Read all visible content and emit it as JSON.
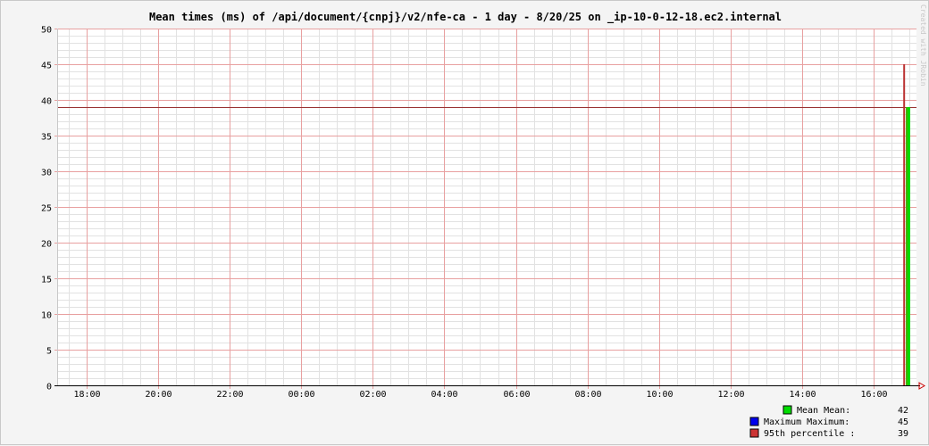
{
  "chart_data": {
    "type": "area",
    "title": "Mean times (ms) of /api/document/{cnpj}/v2/nfe-ca - 1 day - 8/20/25 on _ip-10-0-12-18.ec2.internal",
    "watermark": "Created with JRobin",
    "x_tick_labels": [
      "18:00",
      "20:00",
      "22:00",
      "00:00",
      "02:00",
      "04:00",
      "06:00",
      "08:00",
      "10:00",
      "12:00",
      "14:00",
      "16:00"
    ],
    "x_range_hours": [
      17.2,
      41.2
    ],
    "y_ticks": [
      0,
      5,
      10,
      15,
      20,
      25,
      30,
      35,
      40,
      45,
      50
    ],
    "ylim": [
      0,
      50
    ],
    "grid": true,
    "series": [
      {
        "name": "Mean",
        "color": "#00dd00",
        "x_hours": [
          40.85,
          41.0
        ],
        "values": [
          39,
          39
        ]
      },
      {
        "name": "Maximum",
        "color": "#0000ff",
        "x_hours": [
          40.83,
          41.0
        ],
        "values": [
          45,
          45
        ]
      },
      {
        "name": "95th percentile",
        "color": "#bb3333",
        "x_hours": [
          40.83,
          41.0
        ],
        "values": [
          45,
          45
        ]
      }
    ],
    "threshold_line": {
      "value": 39,
      "color": "#993333"
    },
    "legend": {
      "placement": "bottom-right",
      "rows": [
        {
          "swatch": "#00dd00",
          "text": "Mean  Mean:",
          "value": "42"
        },
        {
          "swatch": "#0000ee",
          "text": "Maximum  Maximum:",
          "value": "45"
        },
        {
          "swatch": "#cc3333",
          "text": "95th percentile  :",
          "value": "39"
        }
      ]
    }
  }
}
